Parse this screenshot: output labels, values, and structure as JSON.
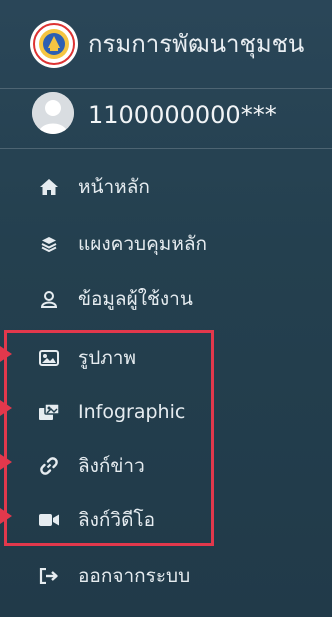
{
  "brand": {
    "title": "กรมการพัฒนาชุมชน",
    "logo_icon": "department-seal-logo"
  },
  "user": {
    "id_masked": "1100000000***",
    "avatar_icon": "user-avatar-placeholder"
  },
  "nav": {
    "items": [
      {
        "label": "หน้าหลัก",
        "icon": "home-icon"
      },
      {
        "label": "แผงควบคุมหลัก",
        "icon": "layers-icon"
      },
      {
        "label": "ข้อมูลผู้ใช้งาน",
        "icon": "user-icon"
      },
      {
        "label": "รูปภาพ",
        "icon": "image-icon"
      },
      {
        "label": "Infographic",
        "icon": "infographic-icon"
      },
      {
        "label": "ลิงก์ข่าว",
        "icon": "link-icon"
      },
      {
        "label": "ลิงก์วิดีโอ",
        "icon": "video-icon"
      },
      {
        "label": "ออกจากระบบ",
        "icon": "logout-icon"
      }
    ]
  },
  "colors": {
    "sidebar_bg": "#24404f",
    "text": "#e6ecf0",
    "highlight": "#e2384c"
  }
}
